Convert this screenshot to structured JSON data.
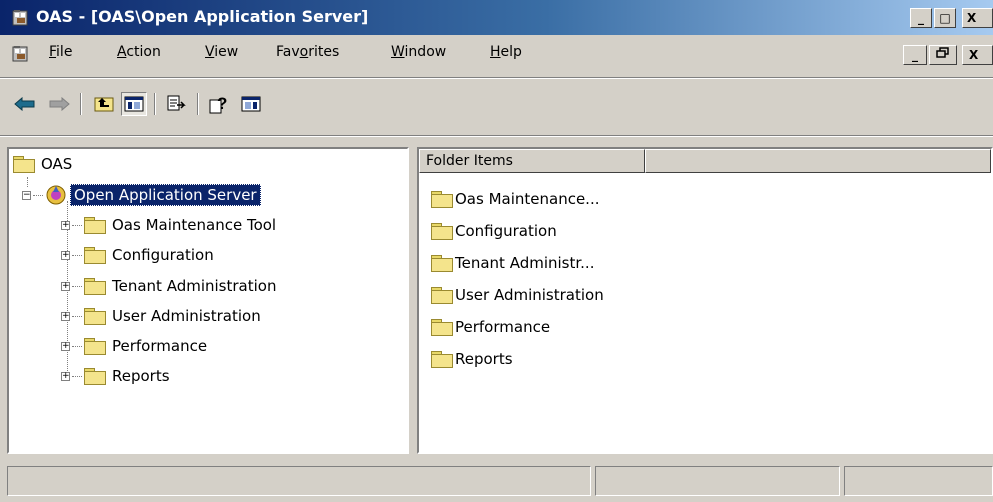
{
  "window": {
    "title": "OAS - [OAS\\Open Application Server]",
    "minimize_glyph": "_",
    "maximize_glyph": "□",
    "close_glyph": "X"
  },
  "menu": {
    "items": [
      {
        "label": "File",
        "underline": "F"
      },
      {
        "label": "Action",
        "underline": "A"
      },
      {
        "label": "View",
        "underline": "V"
      },
      {
        "label": "Favorites",
        "underline": "o"
      },
      {
        "label": "Window",
        "underline": "W"
      },
      {
        "label": "Help",
        "underline": "H"
      }
    ],
    "doc_minimize_glyph": "_",
    "doc_restore_glyph": "🗗",
    "doc_close_glyph": "X"
  },
  "toolbar": {
    "buttons": [
      {
        "name": "back-arrow-icon",
        "glyph": "⇦"
      },
      {
        "name": "forward-arrow-icon",
        "glyph": "⇨"
      },
      {
        "name": "up-one-level-icon",
        "glyph": "⬑"
      },
      {
        "name": "show-hide-tree-icon",
        "glyph": "▥"
      },
      {
        "name": "export-list-icon",
        "glyph": "⎘"
      },
      {
        "name": "help-icon",
        "glyph": "?"
      },
      {
        "name": "show-hide-action-pane-icon",
        "glyph": "▤"
      }
    ]
  },
  "tree": {
    "root": "OAS",
    "server": "Open Application Server",
    "children": [
      "Oas Maintenance Tool",
      "Configuration",
      "Tenant Administration",
      "User Administration",
      "Performance",
      "Reports"
    ]
  },
  "list": {
    "columns": [
      "Folder Items",
      ""
    ],
    "items": [
      "Oas Maintenance...",
      "Configuration",
      "Tenant Administr...",
      "User Administration",
      "Performance",
      "Reports"
    ]
  },
  "colors": {
    "title_gradient_start": "#0a246a",
    "title_gradient_end": "#a6caf0",
    "selection": "#0a246a",
    "folder_yellow": "#f4e48c",
    "chrome": "#d4d0c8"
  }
}
